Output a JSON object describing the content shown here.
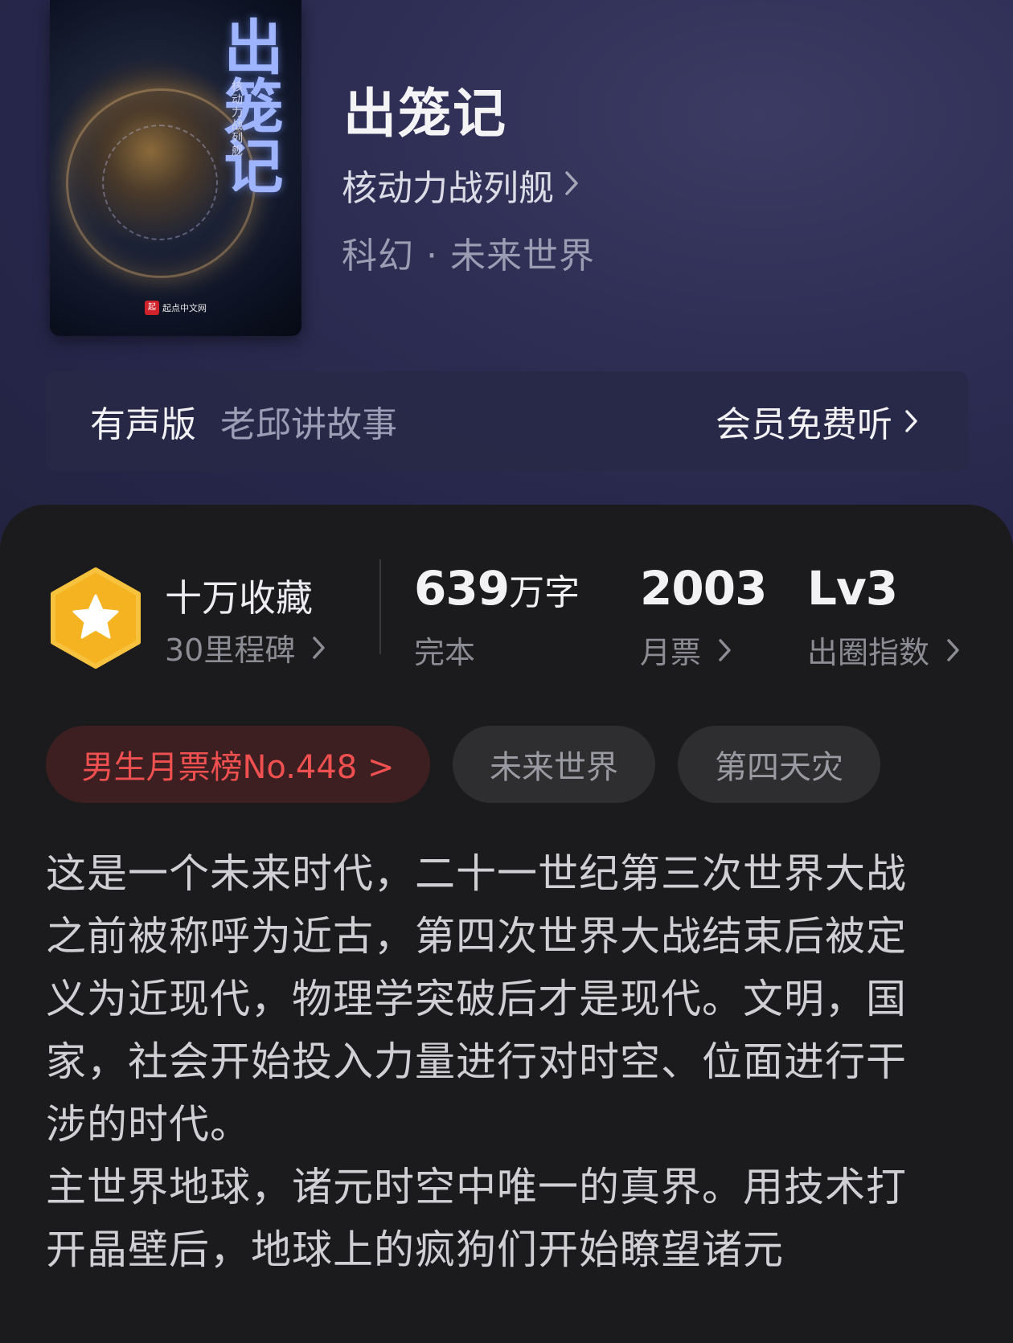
{
  "book": {
    "title": "出笼记",
    "author": "核动力战列舰",
    "genre": "科幻 · 未来世界",
    "cover": {
      "title": "出笼记",
      "author": "核动力战列舰",
      "publisher": "起点中文网",
      "publisher_logo": "起"
    }
  },
  "audio": {
    "label": "有声版",
    "narrator": "老邱讲故事",
    "cta": "会员免费听"
  },
  "stats": {
    "collection": {
      "title": "十万收藏",
      "sub": "30里程碑"
    },
    "words": {
      "num": "639",
      "unit": "万字",
      "sub": "完本"
    },
    "monthly": {
      "num": "2003",
      "sub": "月票"
    },
    "level": {
      "num": "Lv3",
      "sub": "出圈指数"
    }
  },
  "tags": {
    "rank": "男生月票榜No.448 >",
    "tag1": "未来世界",
    "tag2": "第四天灾"
  },
  "synopsis": "这是一个未来时代，二十一世纪第三次世界大战之前被称呼为近古，第四次世界大战结束后被定义为近现代，物理学突破后才是现代。文明，国家，社会开始投入力量进行对时空、位面进行干涉的时代。\n主世界地球，诸元时空中唯一的真界。用技术打开晶壁后，地球上的疯狗们开始瞭望诸元",
  "icons": {
    "chevron": "chevron-right-icon",
    "badge": "star-hexagon-icon"
  },
  "colors": {
    "hero_bg": "#2f2e55",
    "sheet_bg": "#1b1b1d",
    "badge": "#f5b321",
    "rank_text": "#f0504f",
    "rank_bg": "#3d1f21"
  }
}
